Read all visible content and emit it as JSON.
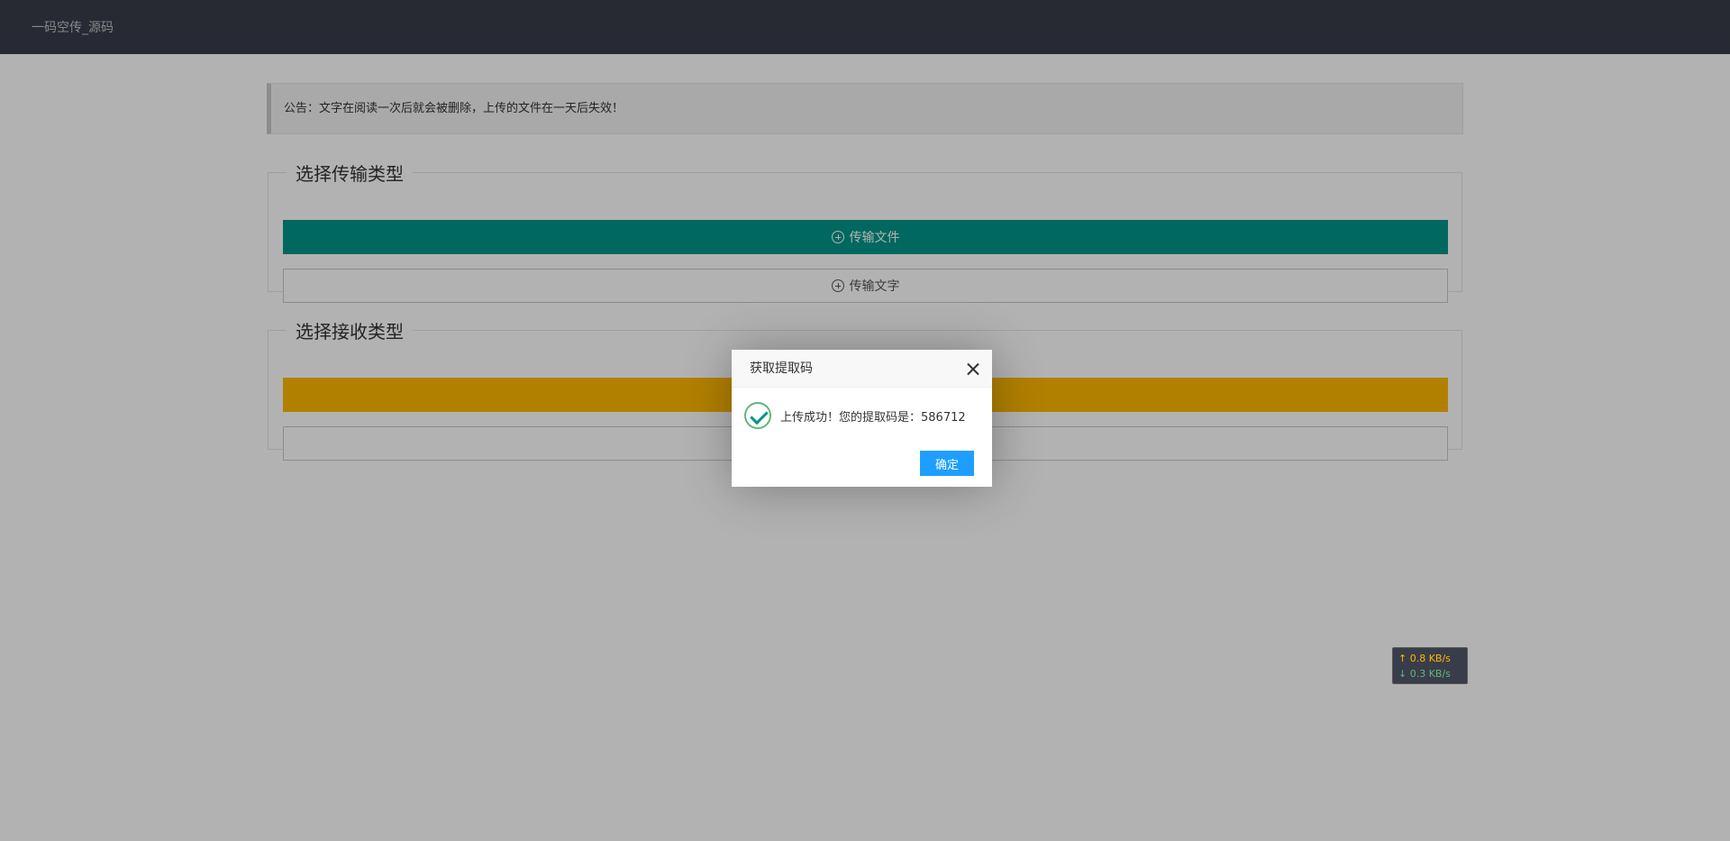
{
  "header": {
    "brand": "一码空传_源码"
  },
  "notice": {
    "text": "公告：文字在阅读一次后就会被删除，上传的文件在一天后失效！"
  },
  "send_group": {
    "legend": "选择传输类型",
    "file_button": "传输文件",
    "text_button": "传输文字"
  },
  "recv_group": {
    "legend": "选择接收类型"
  },
  "dialog": {
    "title": "获取提取码",
    "message": "上传成功！您的提取码是：586712",
    "confirm_label": "确定"
  },
  "speed_monitor": {
    "upload": "↑ 0.8 KB/s",
    "download": "↓ 0.3 KB/s"
  },
  "colors": {
    "header": "#393d49",
    "teal": "#009688",
    "yellow": "#ffb800",
    "blue": "#1e9fff"
  }
}
